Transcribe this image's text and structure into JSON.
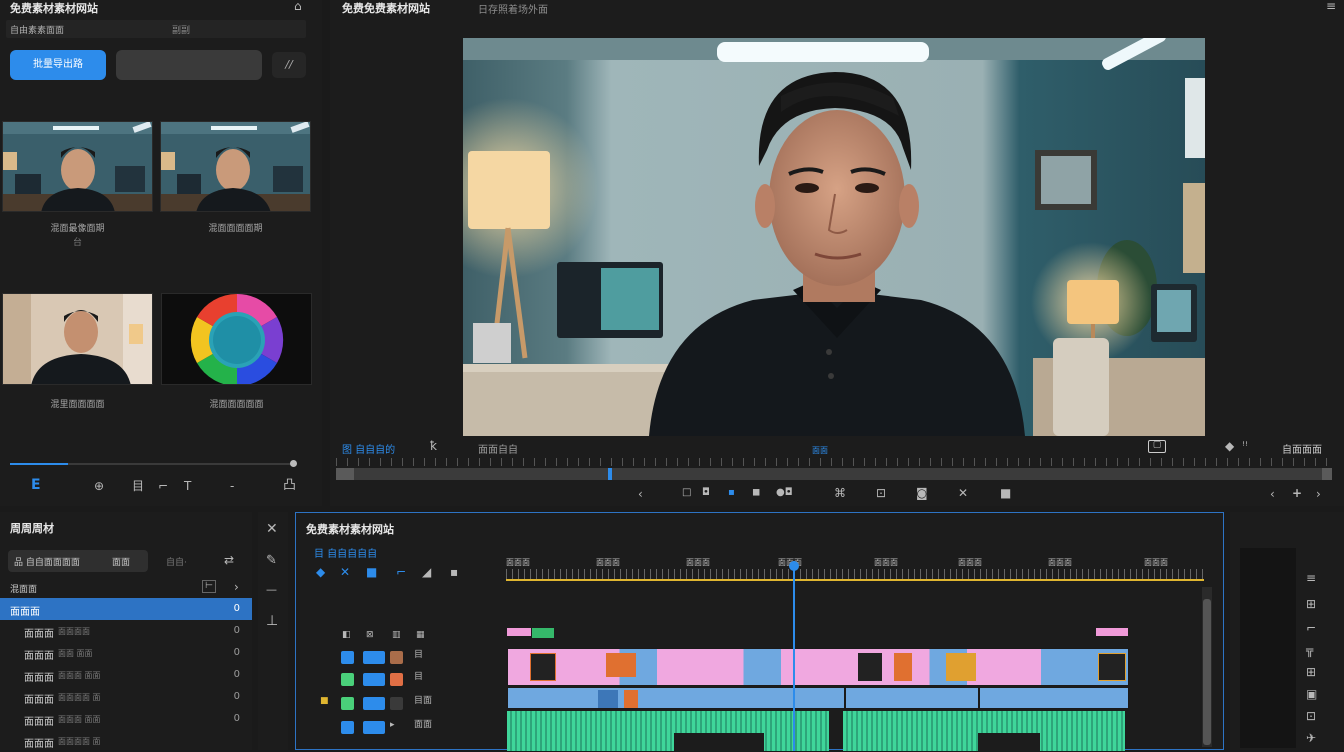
{
  "media_panel": {
    "title": "免费素材素材网站",
    "search_label": "自由素素面面",
    "search_tail": "副副",
    "primary_button": "批量导出路",
    "extra_button": "//",
    "thumbs": [
      {
        "caption": "混面最像面期",
        "sub": "台"
      },
      {
        "caption": "混面面面面期",
        "sub": ""
      },
      {
        "caption": "混里面面面面",
        "sub": ""
      },
      {
        "caption": "混面面面面面",
        "sub": ""
      }
    ],
    "bottom_icons": [
      "E",
      "⊕",
      "目",
      "⌐",
      "T",
      "-",
      "凸"
    ]
  },
  "viewer": {
    "title": "免费免费素材网站",
    "subtitle": "日存照着场外面",
    "left_label": "图 自自自的",
    "left_icon": "ꝁ",
    "mid_label": "面面自自",
    "center_label": "面面",
    "right_label": "自面面面",
    "controls": [
      "‹",
      "□",
      "◘",
      "▪",
      "◼",
      "●◘",
      "⌘",
      "⊡",
      "◙",
      "✕",
      "■"
    ],
    "right_controls": [
      "‹",
      "+",
      "›"
    ]
  },
  "project_panel": {
    "title": "周周周材",
    "tab_active": "品 自自面面面面",
    "tab_second": "面面",
    "tab_third": "自自·",
    "row_header": "混面面",
    "rows": [
      {
        "label": "面面面",
        "tail": "0",
        "selected": true
      },
      {
        "label": "面面面",
        "sub": "面面面面",
        "tail": "0"
      },
      {
        "label": "面面面",
        "sub": "面面 面面",
        "tail": "0"
      },
      {
        "label": "面面面",
        "sub": "面面面 面面",
        "tail": "0"
      },
      {
        "label": "面面面",
        "sub": "面面面面 面",
        "tail": "0"
      },
      {
        "label": "面面面",
        "sub": "面面面 面面",
        "tail": "0"
      },
      {
        "label": "面面面",
        "sub": "面面面面 面",
        "tail": "0"
      }
    ]
  },
  "tools": [
    "✕",
    "✎",
    "—",
    "⊥"
  ],
  "timeline": {
    "title": "免费素材素材网站",
    "sequence_label": "目 自自自自自",
    "timecodes": [
      "面面面",
      "面面面",
      "面面面",
      "面面面",
      "面面面",
      "面面面",
      "面面面",
      "面面面"
    ],
    "tool_icons": [
      "◆",
      "✕",
      "■",
      "⌐",
      "◢",
      "▪"
    ]
  },
  "right_strip_icons": [
    "≡",
    "⊞",
    "⌐",
    "╦",
    "⊞",
    "▣",
    "⊡",
    "✈"
  ]
}
